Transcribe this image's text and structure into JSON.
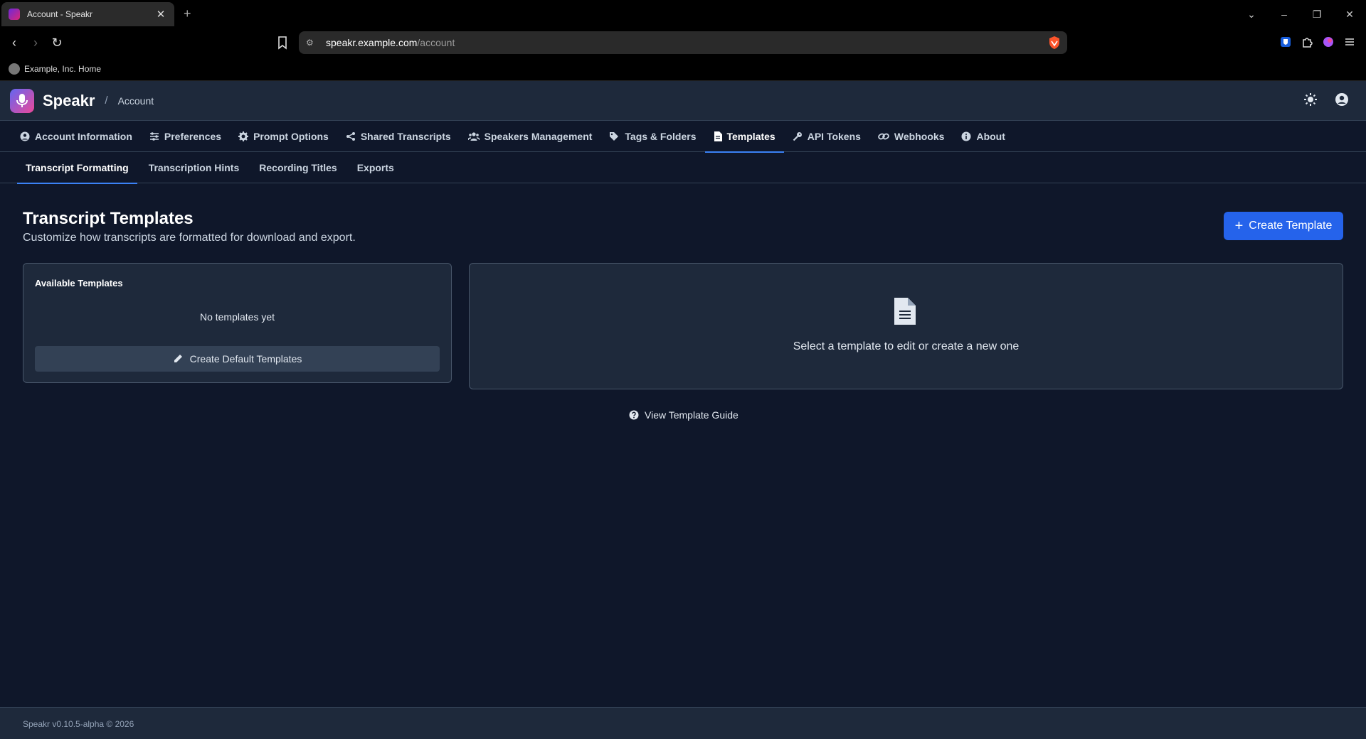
{
  "browser": {
    "tab_title": "Account - Speakr",
    "url_host": "speakr.example.com",
    "url_path": "/account",
    "bookmark_label": "Example, Inc. Home"
  },
  "header": {
    "brand": "Speakr",
    "separator": "/",
    "breadcrumb": "Account"
  },
  "main_nav": [
    {
      "label": "Account Information",
      "icon": "user-circle-icon"
    },
    {
      "label": "Preferences",
      "icon": "sliders-icon"
    },
    {
      "label": "Prompt Options",
      "icon": "gear-icon"
    },
    {
      "label": "Shared Transcripts",
      "icon": "share-icon"
    },
    {
      "label": "Speakers Management",
      "icon": "users-icon"
    },
    {
      "label": "Tags & Folders",
      "icon": "tags-icon"
    },
    {
      "label": "Templates",
      "icon": "file-icon",
      "active": true
    },
    {
      "label": "API Tokens",
      "icon": "key-icon"
    },
    {
      "label": "Webhooks",
      "icon": "link-icon"
    },
    {
      "label": "About",
      "icon": "info-icon"
    }
  ],
  "sub_nav": [
    {
      "label": "Transcript Formatting",
      "active": true
    },
    {
      "label": "Transcription Hints"
    },
    {
      "label": "Recording Titles"
    },
    {
      "label": "Exports"
    }
  ],
  "content": {
    "title": "Transcript Templates",
    "subtitle": "Customize how transcripts are formatted for download and export.",
    "create_button": "Create Template",
    "available_title": "Available Templates",
    "empty_message": "No templates yet",
    "default_button": "Create Default Templates",
    "select_message": "Select a template to edit or create a new one",
    "guide_link": "View Template Guide"
  },
  "footer": {
    "text": "Speakr v0.10.5-alpha © 2026"
  },
  "colors": {
    "background": "#0f172a",
    "surface": "#1e293b",
    "accent": "#2563eb",
    "border": "#334155"
  }
}
